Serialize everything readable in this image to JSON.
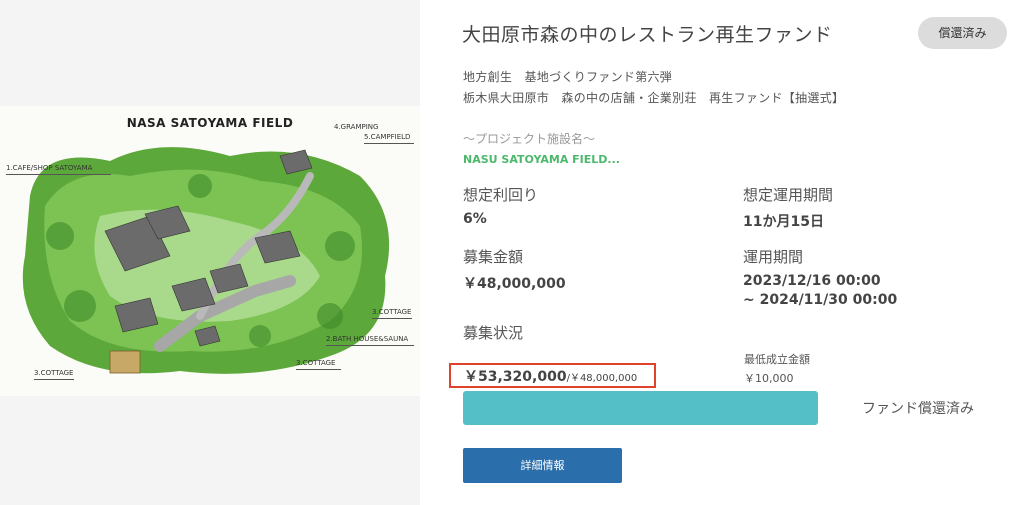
{
  "image": {
    "title": "NASA SATOYAMA FIELD",
    "labels": {
      "glamping": "4.GRAMPING",
      "campfield": "5.CAMPFIELD",
      "cafe": "1.CAFE/SHOP  SATOYAMA",
      "cottage_right": "3.COTTAGE",
      "bath": "2.BATH HOUSE&SAUNA",
      "cottage_center": "3.COTTAGE",
      "cottage_left": "3.COTTAGE"
    }
  },
  "fund": {
    "title": "大田原市森の中のレストラン再生ファンド",
    "status_badge": "償還済み",
    "subtitle_line1": "地方創生　基地づくりファンド第六弾",
    "subtitle_line2": "栃木県大田原市　森の中の店舗・企業別荘　再生ファンド【抽選式】",
    "project_label": "～プロジェクト施設名～",
    "project_name": "NASU SATOYAMA FIELD..."
  },
  "metrics": {
    "yield_label": "想定利回り",
    "yield_value": "6%",
    "period_label": "想定運用期間",
    "period_value": "11か月15日",
    "target_label": "募集金額",
    "target_value": "￥48,000,000",
    "operation_label": "運用期間",
    "operation_start": "2023/12/16 00:00",
    "operation_end": "~ 2024/11/30 00:00",
    "status_label": "募集状況",
    "min_label": "最低成立金額",
    "min_value": "￥10,000"
  },
  "progress": {
    "raised": "￥53,320,000",
    "goal": "/￥48,000,000",
    "fill_percent": 100,
    "status_text": "ファンド償還済み"
  },
  "detail_button": "詳細情報"
}
